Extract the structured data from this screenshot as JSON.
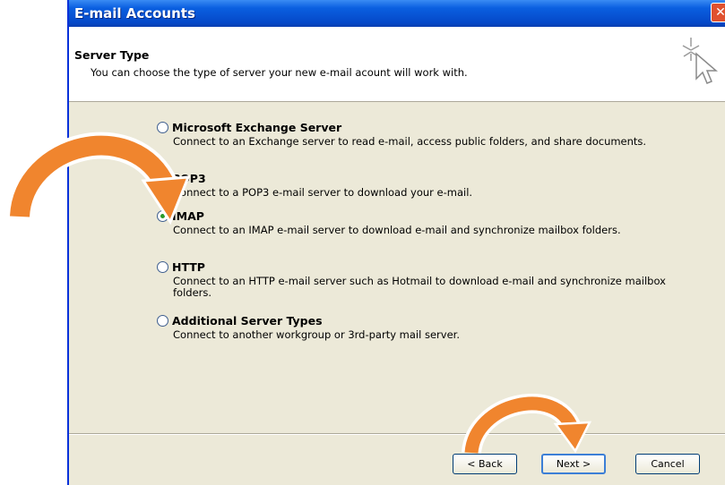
{
  "window": {
    "title": "E-mail Accounts",
    "close_glyph": "✕"
  },
  "header": {
    "title": "Server Type",
    "subtitle": "You can choose the type of server your new e-mail acount will work with."
  },
  "options": [
    {
      "label": "Microsoft Exchange Server",
      "description": "Connect to an Exchange server to read e-mail, access public folders, and share documents.",
      "selected": false
    },
    {
      "label": "POP3",
      "description": "Connect to a POP3 e-mail server to download your e-mail.",
      "selected": false
    },
    {
      "label": "IMAP",
      "description": "Connect to an IMAP e-mail server to download e-mail and synchronize mailbox folders.",
      "selected": true
    },
    {
      "label": "HTTP",
      "description": "Connect to an HTTP e-mail server such as Hotmail to download e-mail and synchronize mailbox folders.",
      "selected": false
    },
    {
      "label": "Additional Server Types",
      "description": "Connect to another workgroup or 3rd-party mail server.",
      "selected": false
    }
  ],
  "buttons": {
    "back": "< Back",
    "next": "Next >",
    "cancel": "Cancel"
  },
  "annotations": {
    "arrow_color": "#f0852e",
    "arrow_outline": "#ffffff"
  },
  "icons": {
    "wizard": "sparkle-cursor-icon",
    "close": "close-icon"
  }
}
